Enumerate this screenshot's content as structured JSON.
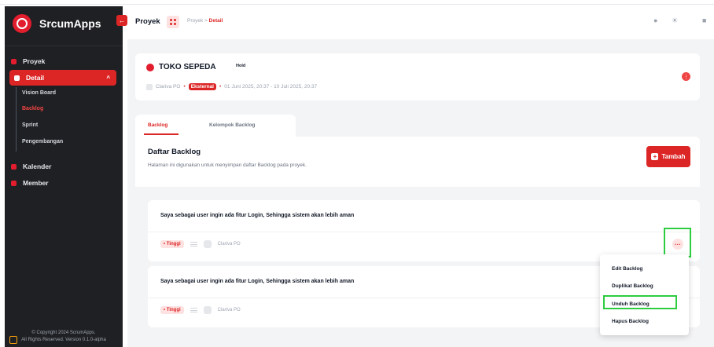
{
  "sidebar": {
    "brand": "SrcumApps",
    "items": [
      {
        "label": "Proyek"
      },
      {
        "label": "Detail"
      },
      {
        "label": "Kalender"
      },
      {
        "label": "Member"
      }
    ],
    "sub_items": [
      {
        "label": "Vision Board"
      },
      {
        "label": "Backlog"
      },
      {
        "label": "Sprint"
      },
      {
        "label": "Pengembangan"
      }
    ],
    "footer_line1": "© Copyright 2024 ScrumApps.",
    "footer_line2": "All Rights Reserved. Version 0.1.0-alpha"
  },
  "topbar": {
    "title": "Proyek",
    "breadcrumb_root": "Proyek",
    "breadcrumb_sep": ">",
    "breadcrumb_current": "Detail"
  },
  "project": {
    "name": "TOKO SEPEDA",
    "status": "Hold",
    "owner": "Clariva PO",
    "type": "Eksternal",
    "date_range": "01 Juni 2025, 20:37 - 10 Juli 2025, 20:37"
  },
  "tabs": [
    {
      "label": "Backlog"
    },
    {
      "label": "Kelompok Backlog"
    }
  ],
  "backlog": {
    "title": "Daftar Backlog",
    "description": "Halaman ini digunakan untuk menyimpan daftar Backlog pada proyek.",
    "add_button": "Tambah",
    "items": [
      {
        "title": "Saya sebagai user ingin ada fitur Login, Sehingga sistem akan lebih aman",
        "priority": "• Tinggi",
        "assignee": "Clariva PO"
      },
      {
        "title": "Saya sebagai user ingin ada fitur Login, Sehingga sistem akan lebih aman",
        "priority": "• Tinggi",
        "assignee": "Clariva PO"
      }
    ]
  },
  "context_menu": {
    "items": [
      {
        "label": "Edit Backlog"
      },
      {
        "label": "Duplikat Backlog"
      },
      {
        "label": "Unduh Backlog"
      },
      {
        "label": "Hapus Backlog"
      }
    ]
  },
  "colors": {
    "accent": "#dc2626",
    "sidebar_bg": "#1f2023",
    "highlight": "#2ecc40"
  }
}
